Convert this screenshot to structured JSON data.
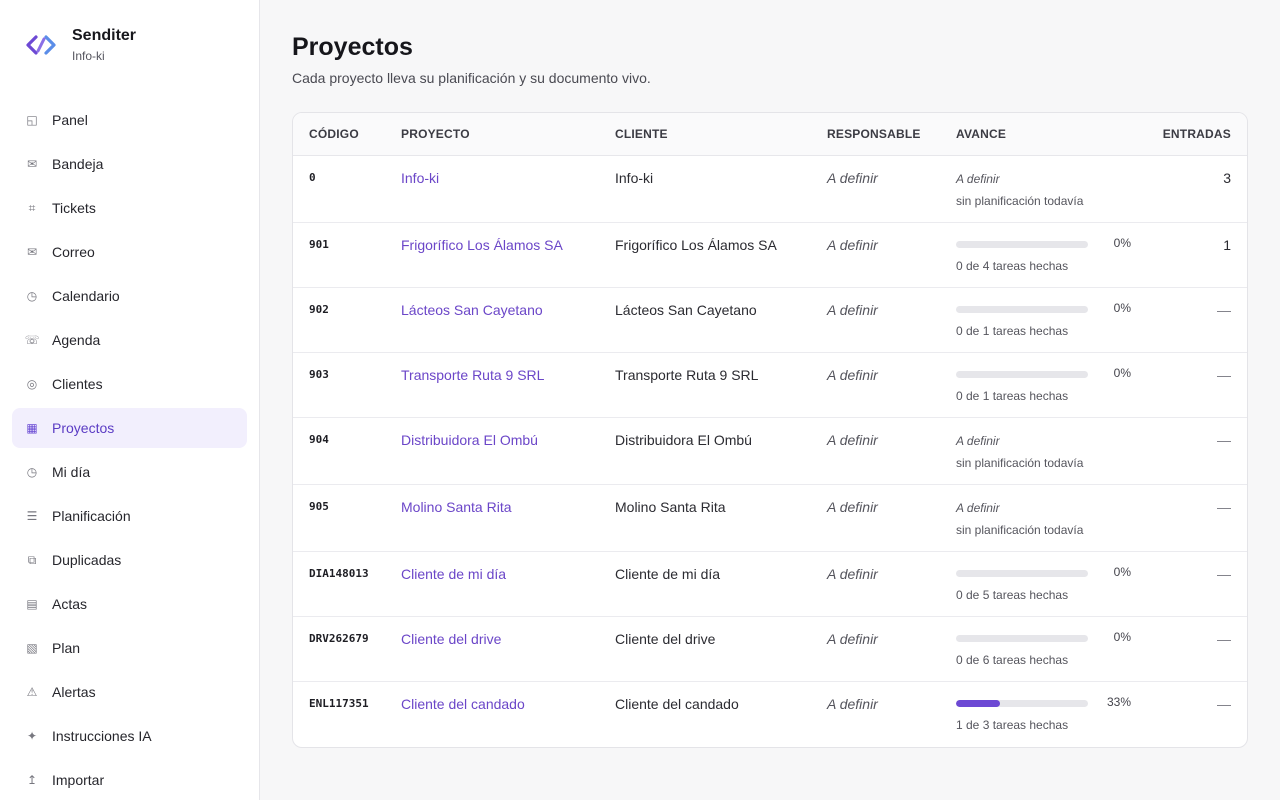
{
  "brand": {
    "name": "Senditer",
    "workspace": "Info-ki"
  },
  "nav": [
    {
      "label": "Panel",
      "icon": "panel-icon",
      "glyph": "◱",
      "active": false
    },
    {
      "label": "Bandeja",
      "icon": "inbox-icon",
      "glyph": "✉",
      "active": false
    },
    {
      "label": "Tickets",
      "icon": "ticket-icon",
      "glyph": "⌗",
      "active": false
    },
    {
      "label": "Correo",
      "icon": "mail-icon",
      "glyph": "✉",
      "active": false
    },
    {
      "label": "Calendario",
      "icon": "calendar-icon",
      "glyph": "◷",
      "active": false
    },
    {
      "label": "Agenda",
      "icon": "phone-icon",
      "glyph": "☏",
      "active": false
    },
    {
      "label": "Clientes",
      "icon": "clients-icon",
      "glyph": "◎",
      "active": false
    },
    {
      "label": "Proyectos",
      "icon": "projects-icon",
      "glyph": "▦",
      "active": true
    },
    {
      "label": "Mi día",
      "icon": "clock-icon",
      "glyph": "◷",
      "active": false
    },
    {
      "label": "Planificación",
      "icon": "list-icon",
      "glyph": "☰",
      "active": false
    },
    {
      "label": "Duplicadas",
      "icon": "duplicate-icon",
      "glyph": "⧉",
      "active": false
    },
    {
      "label": "Actas",
      "icon": "document-icon",
      "glyph": "▤",
      "active": false
    },
    {
      "label": "Plan",
      "icon": "plan-icon",
      "glyph": "▧",
      "active": false
    },
    {
      "label": "Alertas",
      "icon": "alert-icon",
      "glyph": "⚠",
      "active": false
    },
    {
      "label": "Instrucciones IA",
      "icon": "sparkle-icon",
      "glyph": "✦",
      "active": false
    },
    {
      "label": "Importar",
      "icon": "import-icon",
      "glyph": "↥",
      "active": false
    }
  ],
  "page": {
    "title": "Proyectos",
    "subtitle": "Cada proyecto lleva su planificación y su documento vivo."
  },
  "table": {
    "headers": {
      "code": "CÓDIGO",
      "project": "PROYECTO",
      "client": "CLIENTE",
      "owner": "RESPONSABLE",
      "progress": "AVANCE",
      "entries": "ENTRADAS"
    },
    "rows": [
      {
        "code": "0",
        "project": "Info-ki",
        "client": "Info-ki",
        "owner": "A definir",
        "progress_type": "none",
        "progress_label": "A definir",
        "progress_note": "sin planificación todavía",
        "entries": "3"
      },
      {
        "code": "901",
        "project": "Frigorífico Los Álamos SA",
        "client": "Frigorífico Los Álamos SA",
        "owner": "A definir",
        "progress_type": "bar",
        "progress_fraction": 0,
        "progress_pct": "0%",
        "progress_note": "0 de 4 tareas hechas",
        "entries": "1"
      },
      {
        "code": "902",
        "project": "Lácteos San Cayetano",
        "client": "Lácteos San Cayetano",
        "owner": "A definir",
        "progress_type": "bar",
        "progress_fraction": 0,
        "progress_pct": "0%",
        "progress_note": "0 de 1 tareas hechas",
        "entries": "—"
      },
      {
        "code": "903",
        "project": "Transporte Ruta 9 SRL",
        "client": "Transporte Ruta 9 SRL",
        "owner": "A definir",
        "progress_type": "bar",
        "progress_fraction": 0,
        "progress_pct": "0%",
        "progress_note": "0 de 1 tareas hechas",
        "entries": "—"
      },
      {
        "code": "904",
        "project": "Distribuidora El Ombú",
        "client": "Distribuidora El Ombú",
        "owner": "A definir",
        "progress_type": "none",
        "progress_label": "A definir",
        "progress_note": "sin planificación todavía",
        "entries": "—"
      },
      {
        "code": "905",
        "project": "Molino Santa Rita",
        "client": "Molino Santa Rita",
        "owner": "A definir",
        "progress_type": "none",
        "progress_label": "A definir",
        "progress_note": "sin planificación todavía",
        "entries": "—"
      },
      {
        "code": "DIA148013",
        "project": "Cliente de mi día",
        "client": "Cliente de mi día",
        "owner": "A definir",
        "progress_type": "bar",
        "progress_fraction": 0,
        "progress_pct": "0%",
        "progress_note": "0 de 5 tareas hechas",
        "entries": "—"
      },
      {
        "code": "DRV262679",
        "project": "Cliente del drive",
        "client": "Cliente del drive",
        "owner": "A definir",
        "progress_type": "bar",
        "progress_fraction": 0,
        "progress_pct": "0%",
        "progress_note": "0 de 6 tareas hechas",
        "entries": "—"
      },
      {
        "code": "ENL117351",
        "project": "Cliente del candado",
        "client": "Cliente del candado",
        "owner": "A definir",
        "progress_type": "bar",
        "progress_fraction": 0.33,
        "progress_pct": "33%",
        "progress_note": "1 de 3 tareas hechas",
        "entries": "—"
      }
    ]
  },
  "colors": {
    "accent": "#6b46c8",
    "active_bg": "#f2effd",
    "bar_track": "#e6e6ea",
    "bar_fill": "#6d49d4"
  }
}
